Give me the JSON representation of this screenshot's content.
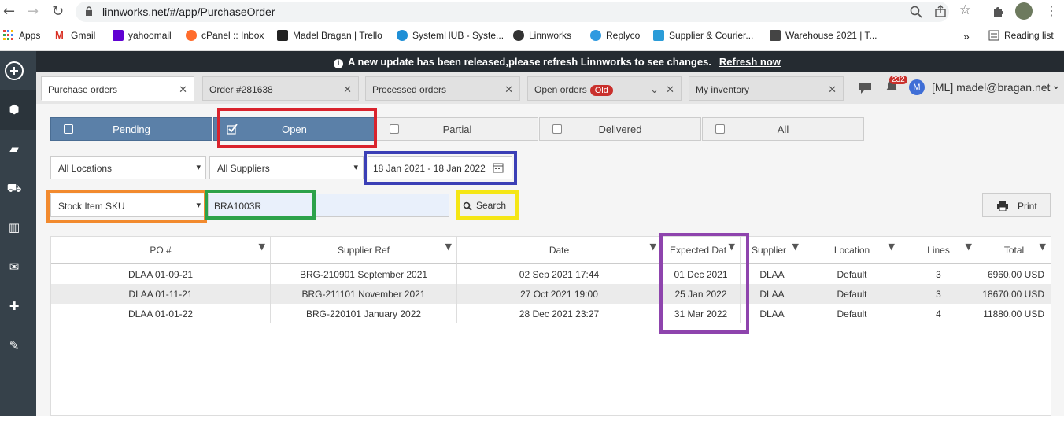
{
  "browser": {
    "url": "linnworks.net/#/app/PurchaseOrder",
    "bookmarks": [
      "Apps",
      "Gmail",
      "yahoomail",
      "cPanel :: Inbox",
      "Madel Bragan | Trello",
      "SystemHUB - Syste...",
      "Linnworks",
      "Replyco",
      "Supplier & Courier...",
      "Warehouse 2021 | T..."
    ],
    "reading_list": "Reading list",
    "more": "»"
  },
  "banner": {
    "message": "A new update has been released,please refresh Linnworks to see changes.",
    "link": "Refresh now"
  },
  "tabs": [
    {
      "label": "Purchase orders"
    },
    {
      "label": "Order #281638"
    },
    {
      "label": "Processed orders"
    },
    {
      "label": "Open orders",
      "badge": "Old"
    },
    {
      "label": "My inventory"
    }
  ],
  "header": {
    "notification_count": "232",
    "avatar_letter": "M",
    "user": "[ML] madel@bragan.net"
  },
  "status_filters": [
    {
      "label": "Pending"
    },
    {
      "label": "Open"
    },
    {
      "label": "Partial"
    },
    {
      "label": "Delivered"
    },
    {
      "label": "All"
    }
  ],
  "filters": {
    "location": "All Locations",
    "supplier": "All Suppliers",
    "date_range": "18 Jan 2021 - 18 Jan 2022",
    "search_type": "Stock Item SKU",
    "search_value": "BRA1003R",
    "search_button": "Search",
    "print_button": "Print"
  },
  "grid": {
    "columns": [
      "PO #",
      "Supplier Ref",
      "Date",
      "Expected Dat",
      "Supplier",
      "Location",
      "Lines",
      "Total"
    ],
    "rows": [
      [
        "DLAA 01-09-21",
        "BRG-210901 September 2021",
        "02 Sep 2021 17:44",
        "01 Dec 2021",
        "DLAA",
        "Default",
        "3",
        "6960.00 USD"
      ],
      [
        "DLAA 01-11-21",
        "BRG-211101 November 2021",
        "27 Oct 2021 19:00",
        "25 Jan 2022",
        "DLAA",
        "Default",
        "3",
        "18670.00 USD"
      ],
      [
        "DLAA 01-01-22",
        "BRG-220101 January 2022",
        "28 Dec 2021 23:27",
        "31 Mar 2022",
        "DLAA",
        "Default",
        "4",
        "11880.00 USD"
      ]
    ]
  },
  "colors": {
    "sidebar": "#36414a",
    "banner": "#252b31",
    "status_active": "#5b80a8",
    "highlight_red": "#d9232d",
    "highlight_blue": "#3b3fb6",
    "highlight_orange": "#f28a2e",
    "highlight_green": "#2ca24a",
    "highlight_yellow": "#f5e614",
    "highlight_purple": "#8e44ad"
  }
}
